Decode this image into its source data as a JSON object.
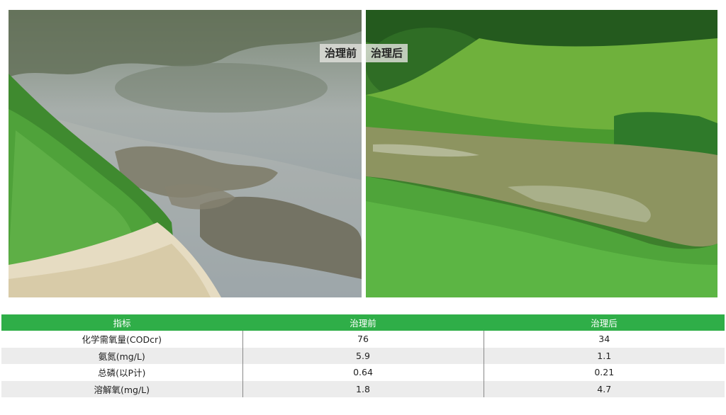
{
  "photos": {
    "before_label": "治理前",
    "after_label": "治理后"
  },
  "table": {
    "headers": [
      "指标",
      "治理前",
      "治理后"
    ],
    "rows": [
      {
        "indicator": "化学需氧量(CODcr)",
        "before": "76",
        "after": "34"
      },
      {
        "indicator": "氨氮(mg/L)",
        "before": "5.9",
        "after": "1.1"
      },
      {
        "indicator": "总磷(以P计)",
        "before": "0.64",
        "after": "0.21"
      },
      {
        "indicator": "溶解氧(mg/L)",
        "before": "1.8",
        "after": "4.7"
      }
    ]
  },
  "colors": {
    "header_green": "#2fae48",
    "row_alt": "#ececec"
  }
}
